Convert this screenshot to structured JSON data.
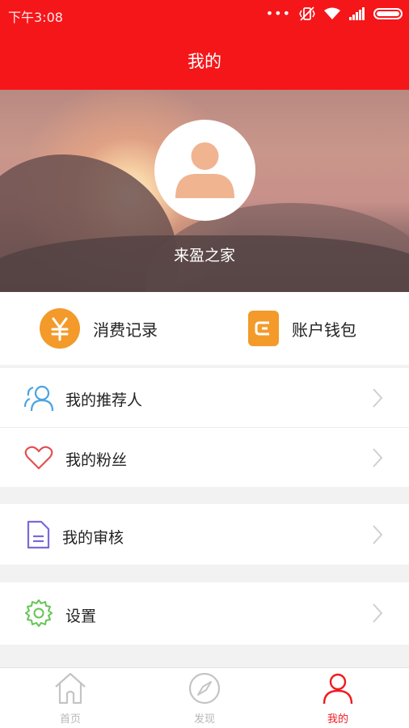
{
  "status_bar": {
    "time": "下午3:08",
    "icons": [
      "more-dots-icon",
      "vibrate-off-icon",
      "wifi-icon",
      "signal-icon",
      "battery-icon"
    ]
  },
  "header": {
    "title": "我的"
  },
  "profile": {
    "username": "来盈之家",
    "avatar_icon": "user-avatar-icon"
  },
  "quick_actions": [
    {
      "label": "消费记录",
      "icon": "yen-icon",
      "color": "#f39a2b"
    },
    {
      "label": "账户钱包",
      "icon": "wallet-icon",
      "color": "#f39a2b"
    }
  ],
  "menu": [
    {
      "label": "我的推荐人",
      "icon": "users-icon",
      "color": "#4aa3e0"
    },
    {
      "label": "我的粉丝",
      "icon": "heart-icon",
      "color": "#e05252"
    },
    {
      "label": "我的审核",
      "icon": "document-icon",
      "color": "#7a6ad8"
    },
    {
      "label": "设置",
      "icon": "gear-icon",
      "color": "#63c552"
    }
  ],
  "tabbar": {
    "items": [
      {
        "label": "首页",
        "icon": "home-icon"
      },
      {
        "label": "发现",
        "icon": "compass-icon"
      },
      {
        "label": "我的",
        "icon": "user-icon"
      }
    ],
    "active_index": 2,
    "active_color": "#f01a20",
    "inactive_color": "#b8b8b8"
  },
  "colors": {
    "brand_red": "#f5161a"
  }
}
